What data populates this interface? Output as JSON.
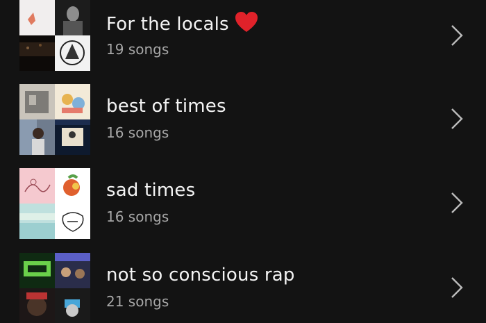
{
  "playlists": [
    {
      "title": "For the locals",
      "count": "19 songs",
      "emoji": "heart-icon"
    },
    {
      "title": "best of times",
      "count": "16 songs"
    },
    {
      "title": "sad times",
      "count": "16 songs"
    },
    {
      "title": "not so conscious rap",
      "count": "21 songs"
    }
  ],
  "colors": {
    "background": "#131313",
    "title": "#f4f4f4",
    "subtitle": "#a7a7a7",
    "heart": "#e0222a"
  }
}
